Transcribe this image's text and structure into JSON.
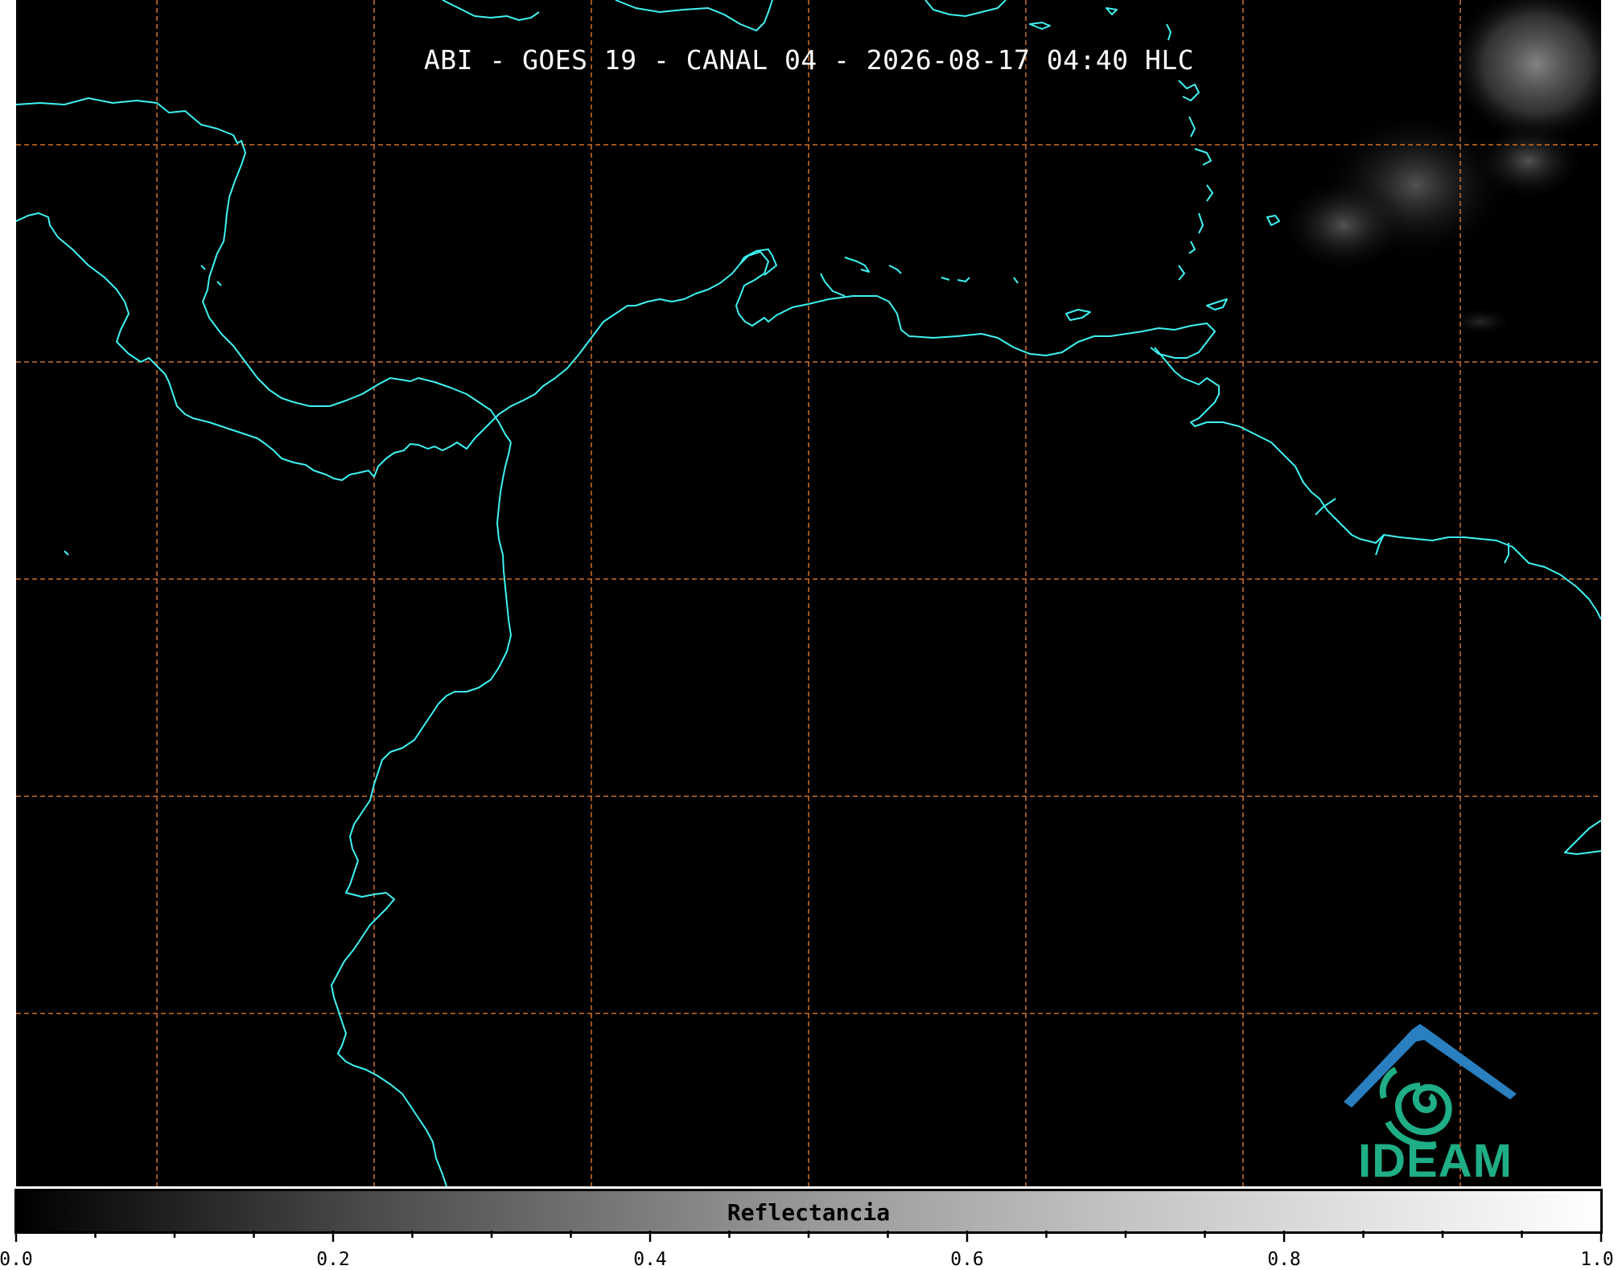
{
  "title": "ABI - GOES 19 - CANAL 04 - 2026-08-17 04:40 HLC",
  "colorbar": {
    "label": "Reflectancia",
    "ticks": [
      "0.0",
      "0.2",
      "0.4",
      "0.6",
      "0.8",
      "1.0"
    ],
    "range": [
      0.0,
      1.0
    ],
    "minor_tick_step": 0.05,
    "colormap": "grayscale"
  },
  "logo": {
    "text": "IDEAM",
    "colors": {
      "text": "#1fae86",
      "roof": "#2a7fc0",
      "swirl": "#1fae86"
    }
  },
  "map": {
    "background": "#000000",
    "coastline_color": "#3ff2f2",
    "gridline_color": "#d0702a",
    "gridline_style": "dashed",
    "gridlines": "on"
  }
}
